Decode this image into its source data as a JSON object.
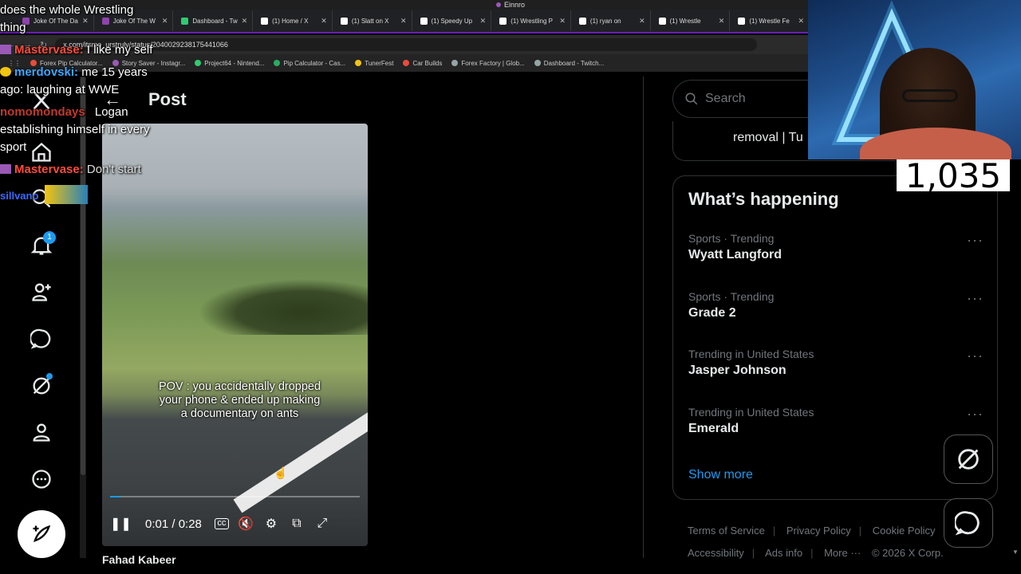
{
  "window": {
    "title": "Einnro"
  },
  "tabs": [
    {
      "label": "Joke Of The Da",
      "color": "#8e44ad"
    },
    {
      "label": "Joke Of The W",
      "color": "#8e44ad"
    },
    {
      "label": "Dashboard - Tw",
      "color": "#9146ff"
    },
    {
      "label": "(1) Home / X",
      "color": "#ffffff"
    },
    {
      "label": "(1) Slatt on X",
      "color": "#ffffff"
    },
    {
      "label": "(1) Speedy Up",
      "color": "#ffffff"
    },
    {
      "label": "(1) Wrestling P",
      "color": "#ffffff"
    },
    {
      "label": "(1) ryan on",
      "color": "#ffffff"
    },
    {
      "label": "(1) Wrestle",
      "color": "#ffffff"
    },
    {
      "label": "(1) Wrestle Fe",
      "color": "#ffffff"
    }
  ],
  "address": {
    "url": "x.com/itsme_urstruly/status/2040029238175441066"
  },
  "bookmarks": [
    {
      "label": "Forex Pip Calculator...",
      "color": "#e74c3c"
    },
    {
      "label": "Story Saver - Instagr...",
      "color": "#9b59b6"
    },
    {
      "label": "Project64 - Nintend...",
      "color": "#2ecc71"
    },
    {
      "label": "Pip Calculator - Cas...",
      "color": "#27ae60"
    },
    {
      "label": "TunerFest",
      "color": "#f1c40f"
    },
    {
      "label": "Car Builds",
      "color": "#e74c3c"
    },
    {
      "label": "Forex Factory | Glob...",
      "color": "#95a5a6"
    },
    {
      "label": "Dashboard - Twitch...",
      "color": "#95a5a6"
    }
  ],
  "nav": {
    "notifications_count": "1"
  },
  "post": {
    "back_arrow": "←",
    "title": "Post"
  },
  "video": {
    "caption": "POV : you accidentally dropped your phone & ended up making a documentary on ants",
    "time": "0:01 / 0:28",
    "progress": 0.04
  },
  "below_video": {
    "author": "Fahad Kabeer"
  },
  "search": {
    "placeholder": "Search"
  },
  "prev_card": {
    "text": "removal | Tu"
  },
  "trends": {
    "heading": "What’s happening",
    "items": [
      {
        "category": "Sports · Trending",
        "name": "Wyatt Langford"
      },
      {
        "category": "Sports · Trending",
        "name": "Grade 2"
      },
      {
        "category": "Trending in United States",
        "name": "Jasper Johnson"
      },
      {
        "category": "Trending in United States",
        "name": "Emerald"
      }
    ],
    "show_more": "Show more"
  },
  "footer": {
    "links": [
      "Terms of Service",
      "Privacy Policy",
      "Cookie Policy",
      "Accessibility",
      "Ads info",
      "More ···"
    ],
    "copyright": "© 2026 X Corp."
  },
  "overlay": {
    "viewer_count": "1,035",
    "chat": [
      {
        "user": "",
        "text": "does the whole Wrestling",
        "color": "#ffffff"
      },
      {
        "user": "",
        "text": "thing",
        "color": "#ffffff"
      },
      {
        "user": "Mastervase:",
        "text": "I like my self",
        "color": "#ff4b3e"
      },
      {
        "user": "merdovski:",
        "text": "me 15 years",
        "color": "#3ea6ff"
      },
      {
        "user": "",
        "text": "ago: laughing at WWE",
        "color": "#ffffff"
      },
      {
        "user": "nomomondays",
        "text": "Logan",
        "color": "#c0392b"
      },
      {
        "user": "",
        "text": "establishing himself in every",
        "color": "#ffffff"
      },
      {
        "user": "",
        "text": "sport",
        "color": "#ffffff"
      },
      {
        "user": "Mastervase:",
        "text": "Don't start",
        "color": "#ff4b3e"
      },
      {
        "user": "sillvano",
        "text": "",
        "color": "#3e6bff"
      }
    ]
  }
}
